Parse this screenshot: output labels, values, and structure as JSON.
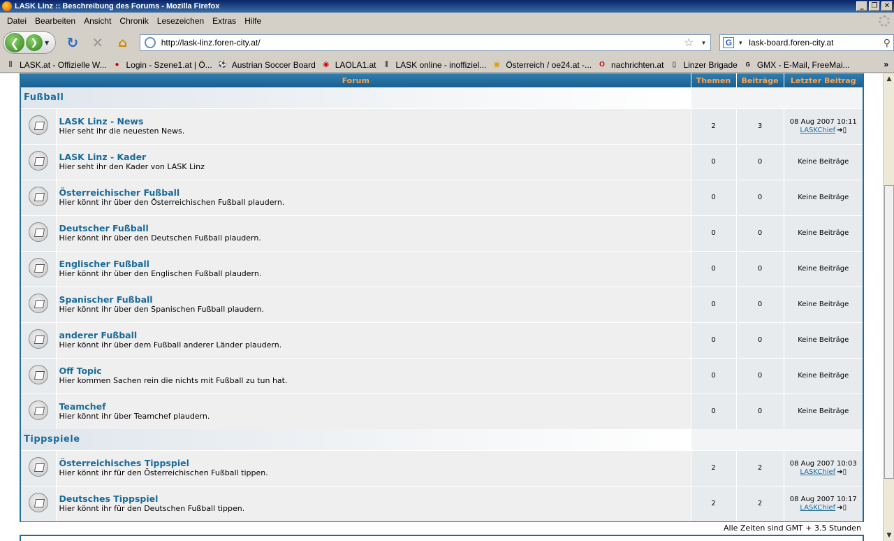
{
  "window": {
    "title": "LASK Linz :: Beschreibung des Forums - Mozilla Firefox"
  },
  "menu": [
    "Datei",
    "Bearbeiten",
    "Ansicht",
    "Chronik",
    "Lesezeichen",
    "Extras",
    "Hilfe"
  ],
  "nav": {
    "url": "http://lask-linz.foren-city.at/",
    "search": "lask-board.foren-city.at"
  },
  "bookmarks": [
    {
      "label": "LASK.at - Offizielle W...",
      "icon": "lask-icon"
    },
    {
      "label": "Login - Szene1.at | Ö...",
      "icon": "szene1-icon"
    },
    {
      "label": "Austrian Soccer Board",
      "icon": "soccer-ball-icon"
    },
    {
      "label": "LAOLA1.at",
      "icon": "laola-icon"
    },
    {
      "label": "LASK online - inoffiziel...",
      "icon": "lask-icon"
    },
    {
      "label": "Österreich / oe24.at -...",
      "icon": "folder-icon"
    },
    {
      "label": "nachrichten.at",
      "icon": "oon-icon"
    },
    {
      "label": "Linzer Brigade",
      "icon": "page-icon"
    },
    {
      "label": "GMX - E-Mail, FreeMai...",
      "icon": "gmx-icon"
    }
  ],
  "table": {
    "headers": {
      "forum": "Forum",
      "themen": "Themen",
      "beitraege": "Beiträge",
      "letzter": "Letzter Beitrag"
    },
    "categories": [
      {
        "name": "Fußball",
        "forums": [
          {
            "name": "LASK Linz - News",
            "desc": "Hier seht ihr die neuesten News.",
            "themen": "2",
            "beitraege": "3",
            "last_date": "08 Aug 2007 10:11",
            "last_user": "LASKChief"
          },
          {
            "name": "LASK Linz - Kader",
            "desc": "Hier seht ihr den Kader von LASK Linz",
            "themen": "0",
            "beitraege": "0",
            "last_text": "Keine Beiträge"
          },
          {
            "name": "Österreichischer Fußball",
            "desc": "Hier könnt ihr über den Österreichischen Fußball plaudern.",
            "themen": "0",
            "beitraege": "0",
            "last_text": "Keine Beiträge"
          },
          {
            "name": "Deutscher Fußball",
            "desc": "Hier könnt ihr über den Deutschen Fußball plaudern.",
            "themen": "0",
            "beitraege": "0",
            "last_text": "Keine Beiträge"
          },
          {
            "name": "Englischer Fußball",
            "desc": "Hier könnt ihr über den Englischen Fußball plaudern.",
            "themen": "0",
            "beitraege": "0",
            "last_text": "Keine Beiträge"
          },
          {
            "name": "Spanischer Fußball",
            "desc": "Hier könnt ihr über den Spanischen Fußball plaudern.",
            "themen": "0",
            "beitraege": "0",
            "last_text": "Keine Beiträge"
          },
          {
            "name": "anderer Fußball",
            "desc": "Hier könnt ihr über dem Fußball anderer Länder plaudern.",
            "themen": "0",
            "beitraege": "0",
            "last_text": "Keine Beiträge"
          },
          {
            "name": "Off Topic",
            "desc": "Hier kommen Sachen rein die nichts mit Fußball zu tun hat.",
            "themen": "0",
            "beitraege": "0",
            "last_text": "Keine Beiträge"
          },
          {
            "name": "Teamchef",
            "desc": "Hier könnt ihr über Teamchef plaudern.",
            "themen": "0",
            "beitraege": "0",
            "last_text": "Keine Beiträge"
          }
        ]
      },
      {
        "name": "Tippspiele",
        "forums": [
          {
            "name": "Österreichisches Tippspiel",
            "desc": "Hier könnt ihr für den Österreichischen Fußball tippen.",
            "themen": "2",
            "beitraege": "2",
            "last_date": "08 Aug 2007 10:03",
            "last_user": "LASKChief"
          },
          {
            "name": "Deutsches Tippspiel",
            "desc": "Hier könnt ihr für den Deutschen Fußball tippen.",
            "themen": "2",
            "beitraege": "2",
            "last_date": "08 Aug 2007 10:17",
            "last_user": "LASKChief"
          }
        ]
      }
    ]
  },
  "footer": {
    "timezone": "Alle Zeiten sind GMT + 3.5 Stunden"
  }
}
